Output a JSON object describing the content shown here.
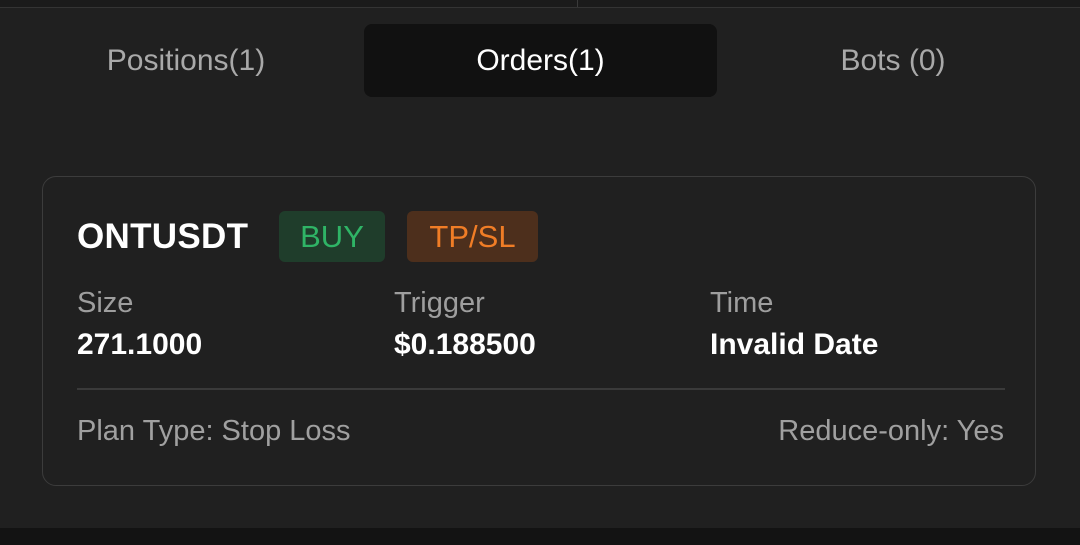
{
  "tabs": [
    {
      "label": "Positions(1)"
    },
    {
      "label": "Orders(1)"
    },
    {
      "label": "Bots (0)"
    }
  ],
  "active_tab": "Orders(1)",
  "order": {
    "symbol": "ONTUSDT",
    "side": "BUY",
    "order_type": "TP/SL",
    "fields": [
      {
        "label": "Size",
        "value": "271.1000"
      },
      {
        "label": "Trigger",
        "value": "$0.188500"
      },
      {
        "label": "Time",
        "value": "Invalid Date"
      }
    ],
    "plan_type": "Plan Type: Stop Loss",
    "reduce_only": "Reduce-only: Yes"
  },
  "colors": {
    "background": "#202020",
    "active_tab_bg": "#111111",
    "buy_text": "#2fb466",
    "buy_bg": "#1f3d2b",
    "tpsl_text": "#f07d26",
    "tpsl_bg": "#4d2f1c"
  }
}
